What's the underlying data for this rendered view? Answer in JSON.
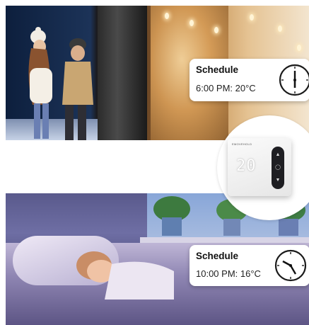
{
  "schedules": [
    {
      "title": "Schedule",
      "time_temp": "6:00 PM: 20°C",
      "clock_icon": "clock-icon"
    },
    {
      "title": "Schedule",
      "time_temp": "10:00 PM: 16°C",
      "clock_icon": "clock-icon"
    }
  ],
  "thermostat": {
    "display": "20",
    "brand": "EMOVEHOLD",
    "up_icon": "chevron-up-icon",
    "mode_icon": "circle-icon",
    "down_icon": "chevron-down-icon"
  },
  "colors": {
    "card_bg": "#ffffff",
    "text": "#111111"
  }
}
